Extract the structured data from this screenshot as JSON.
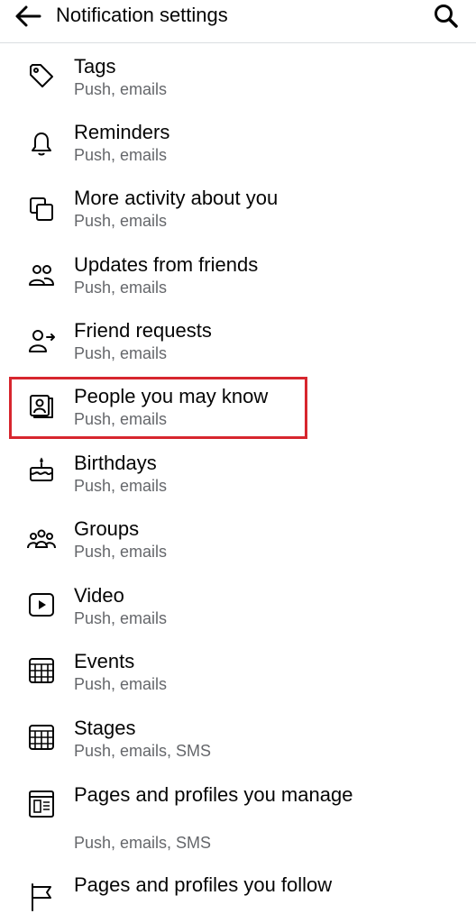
{
  "header": {
    "title": "Notification settings",
    "back_icon": "arrow-left-icon",
    "search_icon": "search-icon"
  },
  "items": [
    {
      "label": "Tags",
      "sub": "Push, emails",
      "icon": "tag-icon"
    },
    {
      "label": "Reminders",
      "sub": "Push, emails",
      "icon": "bell-icon"
    },
    {
      "label": "More activity about you",
      "sub": "Push, emails",
      "icon": "overlapping-squares-icon"
    },
    {
      "label": "Updates from friends",
      "sub": "Push, emails",
      "icon": "friends-icon"
    },
    {
      "label": "Friend requests",
      "sub": "Push, emails",
      "icon": "friend-request-icon"
    },
    {
      "label": "People you may know",
      "sub": "Push, emails",
      "icon": "person-card-icon"
    },
    {
      "label": "Birthdays",
      "sub": "Push, emails",
      "icon": "cake-icon"
    },
    {
      "label": "Groups",
      "sub": "Push, emails",
      "icon": "groups-icon"
    },
    {
      "label": "Video",
      "sub": "Push, emails",
      "icon": "play-icon"
    },
    {
      "label": "Events",
      "sub": "Push, emails",
      "icon": "calendar-icon"
    },
    {
      "label": "Stages",
      "sub": "Push, emails, SMS",
      "icon": "calendar-icon"
    },
    {
      "label": "Pages and profiles you manage",
      "sub": "Push, emails, SMS",
      "icon": "page-icon"
    },
    {
      "label": "Pages and profiles you follow",
      "sub": "",
      "icon": "flag-icon"
    }
  ],
  "highlight_color": "#d7262e"
}
